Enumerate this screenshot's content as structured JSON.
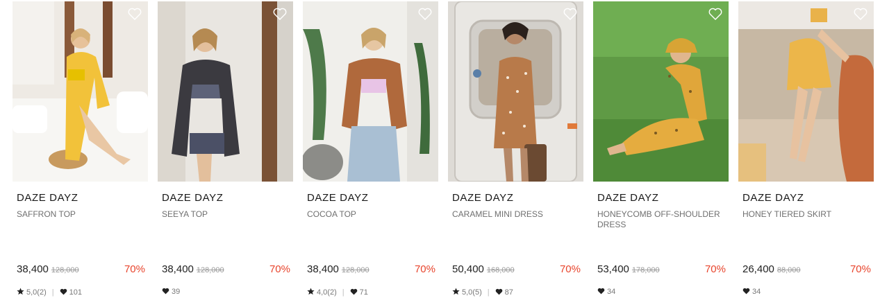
{
  "colors": {
    "discount": "#e8442c",
    "text": "#1a1a1a",
    "muted": "#6f6f6f"
  },
  "icons": {
    "wishlist": "heart-outline-icon",
    "rating": "star-icon",
    "likes": "heart-icon"
  },
  "products": [
    {
      "brand": "DAZE DAYZ",
      "name": "SAFFRON TOP",
      "price": "38,400",
      "original_price": "128,000",
      "discount": "70%",
      "rating": "5,0(2)",
      "likes": "101"
    },
    {
      "brand": "DAZE DAYZ",
      "name": "SEEYA TOP",
      "price": "38,400",
      "original_price": "128,000",
      "discount": "70%",
      "rating": "",
      "likes": "39"
    },
    {
      "brand": "DAZE DAYZ",
      "name": "COCOA TOP",
      "price": "38,400",
      "original_price": "128,000",
      "discount": "70%",
      "rating": "4,0(2)",
      "likes": "71"
    },
    {
      "brand": "DAZE DAYZ",
      "name": "CARAMEL MINI DRESS",
      "price": "50,400",
      "original_price": "168,000",
      "discount": "70%",
      "rating": "5,0(5)",
      "likes": "87"
    },
    {
      "brand": "DAZE DAYZ",
      "name": "HONEYCOMB OFF-SHOULDER DRESS",
      "price": "53,400",
      "original_price": "178,000",
      "discount": "70%",
      "rating": "",
      "likes": "34"
    },
    {
      "brand": "DAZE DAYZ",
      "name": "HONEY TIERED SKIRT",
      "price": "26,400",
      "original_price": "88,000",
      "discount": "70%",
      "rating": "",
      "likes": "34"
    }
  ]
}
